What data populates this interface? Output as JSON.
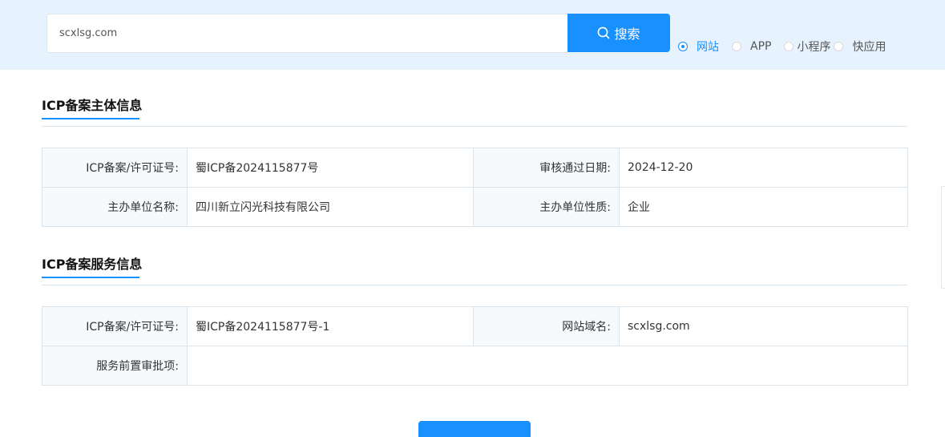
{
  "search": {
    "value": "scxlsg.com",
    "button_label": "搜索"
  },
  "radio_options": [
    {
      "label": "网站",
      "checked": true
    },
    {
      "label": "APP",
      "checked": false
    },
    {
      "label": "小程序",
      "checked": false
    },
    {
      "label": "快应用",
      "checked": false
    }
  ],
  "subject": {
    "title": "ICP备案主体信息",
    "rows": [
      {
        "label1": "ICP备案/许可证号:",
        "value1": "蜀ICP备2024115877号",
        "label2": "审核通过日期:",
        "value2": "2024-12-20"
      },
      {
        "label1": "主办单位名称:",
        "value1": "四川新立闪光科技有限公司",
        "label2": "主办单位性质:",
        "value2": "企业"
      }
    ]
  },
  "service": {
    "title": "ICP备案服务信息",
    "row1": {
      "label1": "ICP备案/许可证号:",
      "value1": "蜀ICP备2024115877号-1",
      "label2": "网站域名:",
      "value2": "scxlsg.com"
    },
    "row2": {
      "label": "服务前置审批项:",
      "value": ""
    }
  },
  "colors": {
    "accent": "#1890ff",
    "topbar_bg": "#e6f2fd",
    "label_cell_bg": "#f7fafd",
    "border": "#dbe3eb"
  },
  "icons": {
    "search_button": "search-icon"
  }
}
